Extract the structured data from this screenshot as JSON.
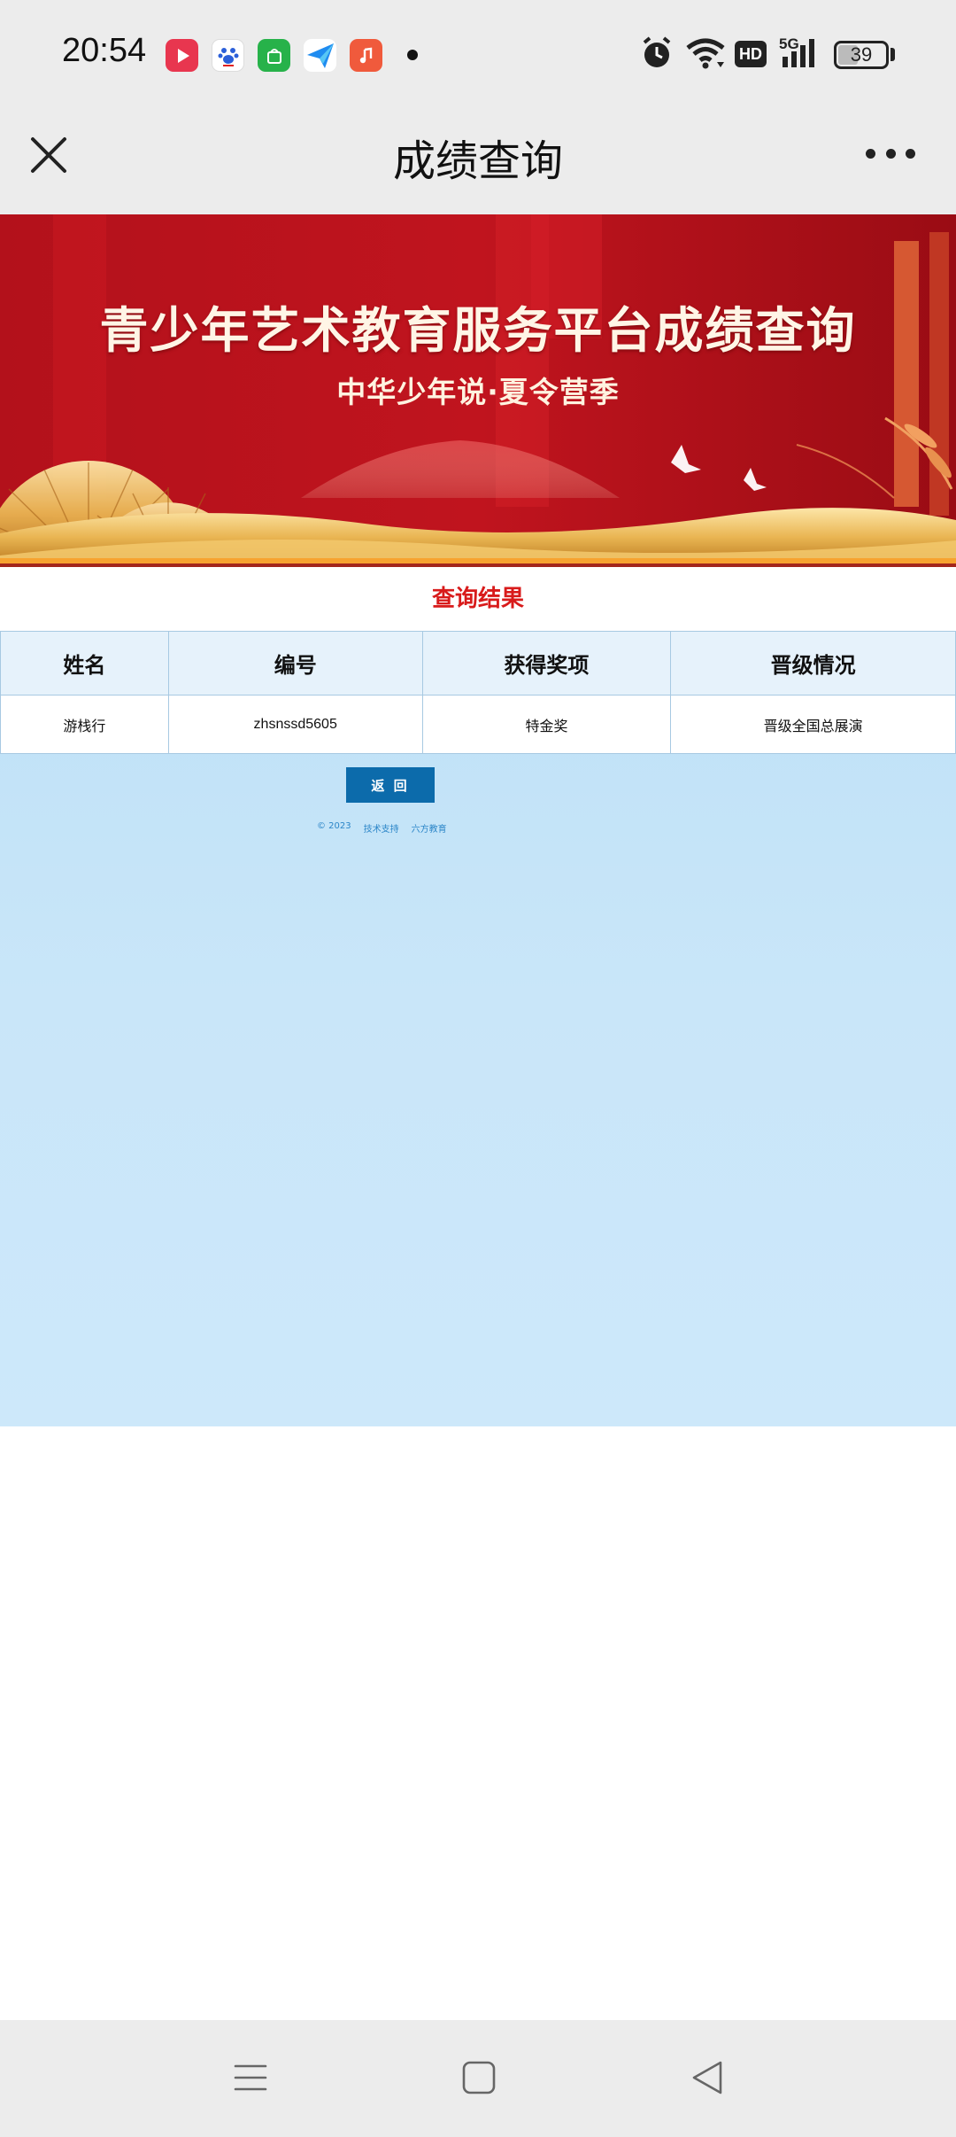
{
  "status_bar": {
    "time": "20:54",
    "notifications": [
      {
        "icon": "video-app-icon",
        "color": "#e8364f"
      },
      {
        "icon": "baidu-app-icon",
        "color": "#ffffff"
      },
      {
        "icon": "shopping-app-icon",
        "color": "#27b24a"
      },
      {
        "icon": "send-app-icon",
        "color": "#1f8cf0"
      },
      {
        "icon": "music-app-icon",
        "color": "#f05a3c"
      }
    ],
    "alarm_icon": "alarm-icon",
    "wifi_icon": "wifi-icon",
    "hd_label": "HD",
    "network_label": "5G",
    "battery_level": "39"
  },
  "nav": {
    "title": "成绩查询",
    "close_icon": "close-icon",
    "more_icon": "more-icon"
  },
  "banner": {
    "title": "青少年艺术教育服务平台成绩查询",
    "subtitle": "中华少年说·夏令营季"
  },
  "result": {
    "heading": "查询结果",
    "columns": [
      "姓名",
      "编号",
      "获得奖项",
      "晋级情况"
    ],
    "rows": [
      [
        "游栈行",
        "zhsnssd5605",
        "特金奖",
        "晋级全国总展演"
      ]
    ],
    "back_label": "返 回"
  },
  "footer": {
    "copyright": "© 2023",
    "support_label": "技术支持",
    "company": "六方教育"
  },
  "colors": {
    "banner_red": "#b8101a",
    "heading_red": "#d81b1b",
    "button_blue": "#0c6bab",
    "content_bg": "#c9e6f9"
  }
}
